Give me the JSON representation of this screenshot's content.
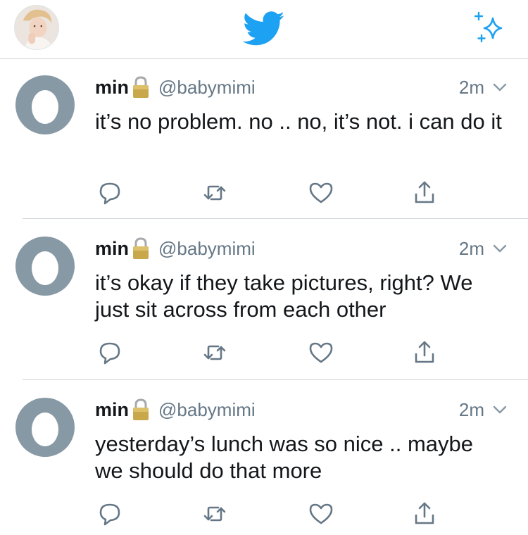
{
  "header": {
    "logo_icon": "twitter-bird-icon",
    "compose_icon": "sparkle-icon",
    "brand_color": "#1da1f2"
  },
  "tweets": [
    {
      "name": "min",
      "handle": "@babymimi",
      "time": "2m",
      "text": "it’s no problem. no .. no, it’s not. i can do it"
    },
    {
      "name": "min",
      "handle": "@babymimi",
      "time": "2m",
      "text": "it’s okay if they take pictures, right? We just sit across from each other"
    },
    {
      "name": "min",
      "handle": "@babymimi",
      "time": "2m",
      "text": "yesterday’s lunch was so nice .. maybe we should do that more"
    }
  ],
  "icons": {
    "reply": "reply-icon",
    "retweet": "retweet-icon",
    "like": "heart-icon",
    "share": "share-icon",
    "lock": "lock-icon",
    "caret": "chevron-down-icon"
  },
  "colors": {
    "text": "#14171a",
    "secondary": "#657786",
    "egg": "#8899a6",
    "divider": "#cfd6db"
  }
}
